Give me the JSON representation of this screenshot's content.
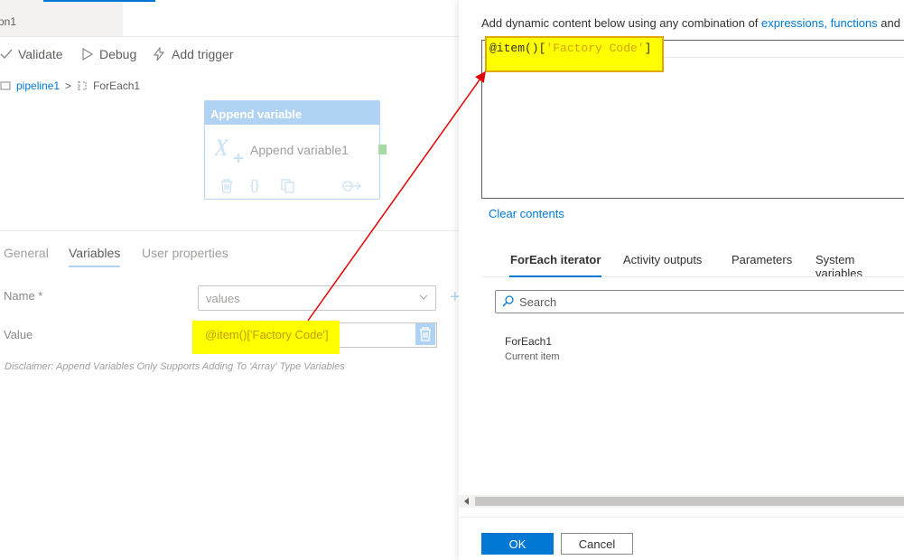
{
  "canvas": {
    "tab_label": "on1",
    "toolbar": {
      "validate": "Validate",
      "debug": "Debug",
      "add_trigger": "Add trigger"
    },
    "breadcrumb": {
      "pipeline": "pipeline1",
      "separator": ">",
      "activity": "ForEach1"
    },
    "activity": {
      "type_label": "Append variable",
      "name": "Append variable1",
      "code_glyph": "{}"
    }
  },
  "properties": {
    "tabs": [
      "General",
      "Variables",
      "User properties"
    ],
    "active_tab": "Variables",
    "name_label": "Name *",
    "name_value": "values",
    "value_label": "Value",
    "value_text": "@item()['Factory Code']",
    "disclaimer": "Disclaimer: Append Variables Only Supports Adding To 'Array' Type Variables"
  },
  "expression_builder": {
    "hint_prefix": "Add dynamic content below using any combination of ",
    "hint_link1": "expressions,",
    "hint_link2": "functions",
    "hint_suffix": " and",
    "expr_prefix": "@item()[",
    "expr_string": "'Factory Code'",
    "expr_suffix": "]",
    "clear_label": "Clear contents",
    "tabs": [
      "ForEach iterator",
      "Activity outputs",
      "Parameters",
      "System variables"
    ],
    "active_tab": "ForEach iterator",
    "search_placeholder": "Search",
    "items": [
      {
        "title": "ForEach1",
        "subtitle": "Current item"
      }
    ],
    "ok_label": "OK",
    "cancel_label": "Cancel"
  },
  "colors": {
    "accent": "#0078d4",
    "highlight": "#ffff00",
    "annotation_arrow": "#e00000"
  }
}
